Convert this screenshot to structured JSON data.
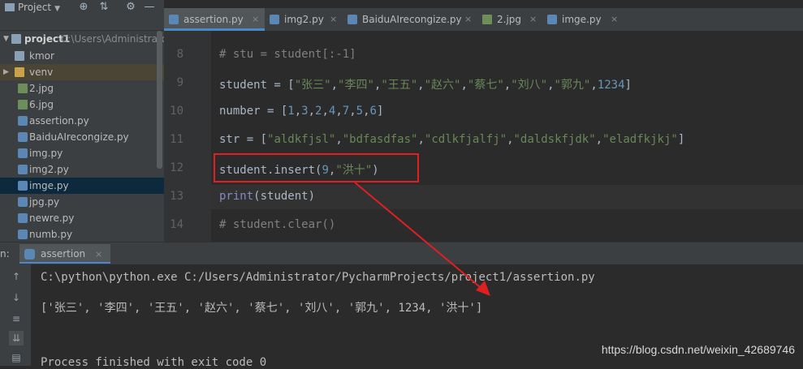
{
  "project_panel": {
    "title": "Project",
    "root": {
      "name": "project1",
      "path": "C:\\Users\\Administrato"
    },
    "items": [
      {
        "label": "kmor"
      },
      {
        "label": "venv"
      },
      {
        "label": "2.jpg"
      },
      {
        "label": "6.jpg"
      },
      {
        "label": "assertion.py"
      },
      {
        "label": "BaiduAIrecongize.py"
      },
      {
        "label": "img.py"
      },
      {
        "label": "img2.py"
      },
      {
        "label": "imge.py"
      },
      {
        "label": "jpg.py"
      },
      {
        "label": "newre.py"
      },
      {
        "label": "numb.py"
      }
    ]
  },
  "tabs": [
    {
      "label": "assertion.py"
    },
    {
      "label": "img2.py"
    },
    {
      "label": "BaiduAIrecongize.py"
    },
    {
      "label": "2.jpg"
    },
    {
      "label": "imge.py"
    }
  ],
  "editor": {
    "lines": [
      {
        "num": "8",
        "text": "# stu = student[:-1]"
      },
      {
        "num": "9",
        "text": "student = [\"张三\",\"李四\",\"王五\",\"赵六\",\"蔡七\",\"刘八\",\"郭九\",1234]"
      },
      {
        "num": "10",
        "text": "number = [1,3,2,4,7,5,6]"
      },
      {
        "num": "11",
        "text": "str = [\"aldkfjsl\",\"bdfasdfas\",\"cdlkfjalfj\",\"daldskfjdk\",\"eladfkjkj\"]"
      },
      {
        "num": "12",
        "text": "student.insert(9,\"洪十\")"
      },
      {
        "num": "13",
        "text": "print(student)"
      },
      {
        "num": "14",
        "text": "# student.clear()"
      }
    ]
  },
  "run": {
    "prefix": "n:",
    "tab_label": "assertion",
    "output": [
      "C:\\python\\python.exe C:/Users/Administrator/PycharmProjects/project1/assertion.py",
      "['张三', '李四', '王五', '赵六', '蔡七', '刘八', '郭九', 1234, '洪十']",
      "",
      "Process finished with exit code 0"
    ]
  },
  "watermark": "https://blog.csdn.net/weixin_42689746",
  "colors": {
    "highlight_box": "#e02020",
    "arrow": "#e02020"
  }
}
